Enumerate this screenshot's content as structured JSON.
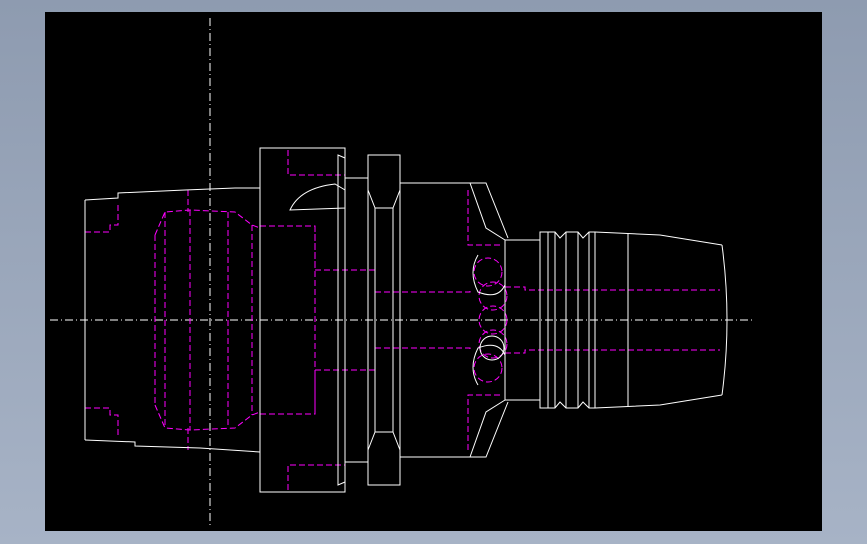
{
  "viewer": {
    "background_color": "#000000",
    "frame_color": "#9aa7bb",
    "visible_line_color": "#ffffff",
    "hidden_line_color": "#ff00ff"
  },
  "drawing": {
    "view": "side-elevation",
    "part": "tool-holder",
    "labels": []
  }
}
